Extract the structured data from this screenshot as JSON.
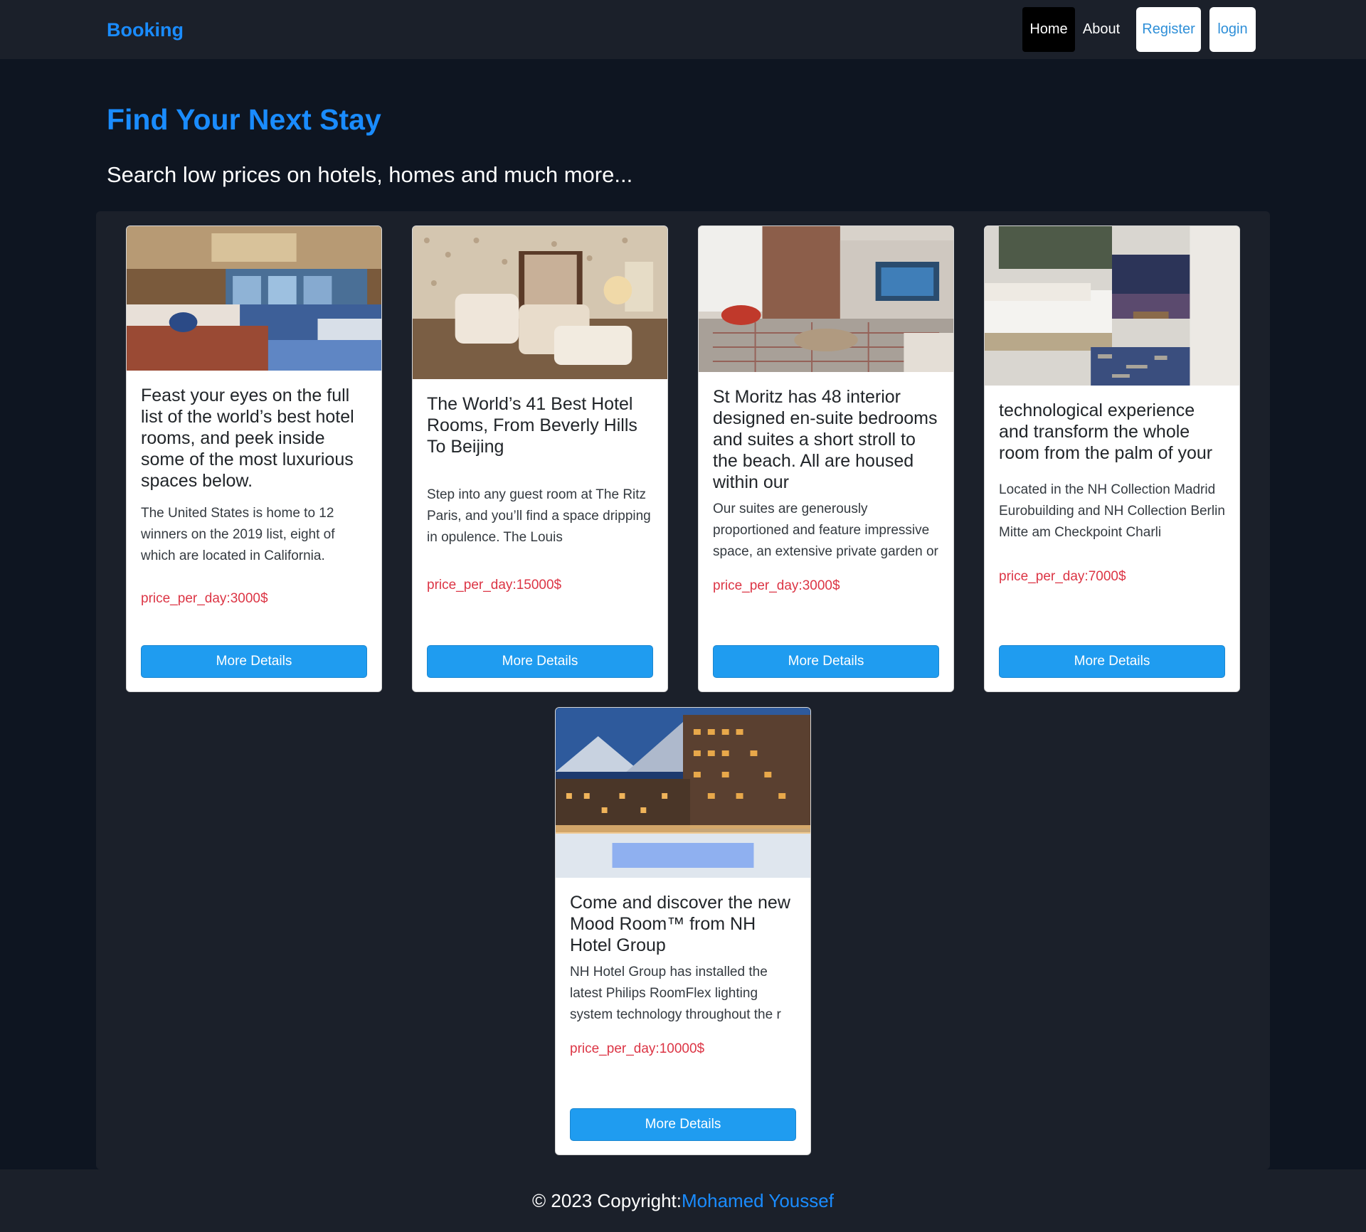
{
  "navbar": {
    "brand": "Booking",
    "links": [
      {
        "label": "Home",
        "active": true
      },
      {
        "label": "About",
        "active": false
      }
    ],
    "buttons": {
      "register": "Register",
      "login": "login"
    }
  },
  "hero": {
    "title": "Find Your Next Stay",
    "subtitle": "Search low prices on hotels, homes and much more..."
  },
  "cards": [
    {
      "title": "Feast your eyes on the full list of the world’s best hotel rooms, and peek inside some of the most luxurious spaces below.",
      "text": "The United States is home to 12 winners on the 2019 list, eight of which are located in California.",
      "price": "price_per_day:3000$",
      "button": "More Details"
    },
    {
      "title": "The World’s 41 Best Hotel Rooms, From Beverly Hills To Beijing",
      "text": "Step into any guest room at The Ritz Paris, and you’ll find a space dripping in opulence. The Louis",
      "price": "price_per_day:15000$",
      "button": "More Details"
    },
    {
      "title": "St Moritz has 48 interior designed en-suite bedrooms and suites a short stroll to the beach. All are housed within our",
      "text": "Our suites are generously proportioned and feature impressive space, an extensive private garden or",
      "price": "price_per_day:3000$",
      "button": "More Details"
    },
    {
      "title": "technological experience and transform the whole room from the palm of your",
      "text": "Located in the NH Collection Madrid Eurobuilding and NH Collection Berlin Mitte am Checkpoint Charli",
      "price": "price_per_day:7000$",
      "button": "More Details"
    },
    {
      "title": "Come and discover the new Mood Room™ from NH Hotel Group",
      "text": "NH Hotel Group has installed the latest Philips RoomFlex lighting system technology throughout the r",
      "price": "price_per_day:10000$",
      "button": "More Details"
    }
  ],
  "footer": {
    "prefix": "© 2023 Copyright:",
    "author": "Mohamed Youssef"
  }
}
